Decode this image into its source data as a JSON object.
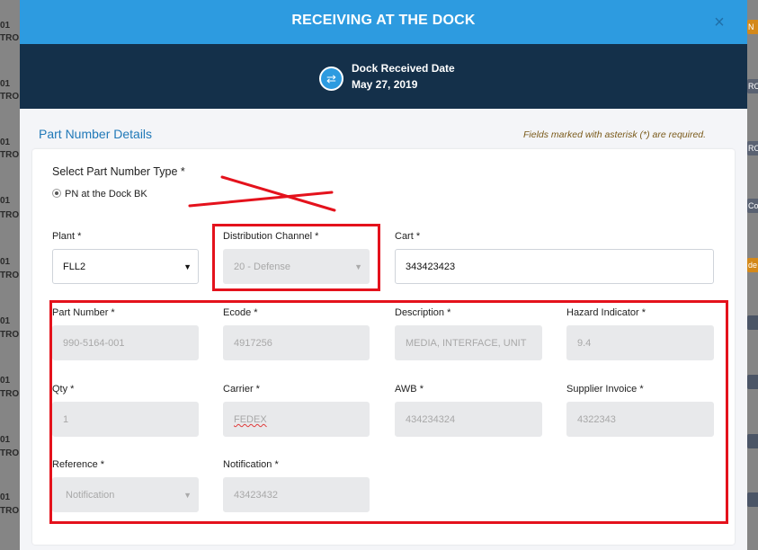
{
  "background": {
    "left_fragments": [
      "01",
      "TRO",
      "01",
      "TRO",
      "01",
      "TRO",
      "01",
      "TRO",
      "01",
      "TRO",
      "01",
      "TRO",
      "01",
      "TRO",
      "01",
      "TRO",
      "01",
      "TRO",
      "01",
      "TRO"
    ],
    "right_fragments": [
      "N",
      "RO",
      "RO",
      "Co",
      "de"
    ]
  },
  "modal": {
    "title": "RECEIVING AT THE DOCK",
    "close_label": "×",
    "dock": {
      "label": "Dock Received Date",
      "date": "May 27, 2019",
      "icon": "swap-arrows-icon"
    },
    "section_title": "Part Number Details",
    "required_note": "Fields marked with asterisk (*) are required.",
    "part_type": {
      "label": "Select Part Number Type *",
      "option_label": "PN at the Dock BK",
      "selected": true
    },
    "fields": {
      "plant": {
        "label": "Plant *",
        "value": "FLL2"
      },
      "distribution_channel": {
        "label": "Distribution Channel *",
        "value": "20 - Defense"
      },
      "cart": {
        "label": "Cart *",
        "value": "343423423"
      },
      "part_number": {
        "label": "Part Number *",
        "value": "990-5164-001"
      },
      "ecode": {
        "label": "Ecode *",
        "value": "4917256"
      },
      "description": {
        "label": "Description *",
        "value": "MEDIA, INTERFACE, UNIT"
      },
      "hazard_indicator": {
        "label": "Hazard Indicator *",
        "value": "9.4"
      },
      "qty": {
        "label": "Qty *",
        "value": "1"
      },
      "carrier": {
        "label": "Carrier *",
        "value": "FEDEX"
      },
      "awb": {
        "label": "AWB *",
        "value": "434234324"
      },
      "supplier_invoice": {
        "label": "Supplier Invoice *",
        "value": "4322343"
      },
      "reference": {
        "label": "Reference *",
        "value": "Notification"
      },
      "notification": {
        "label": "Notification *",
        "value": "43423432"
      }
    },
    "colors": {
      "header": "#2d9be0",
      "dock_band": "#14304a",
      "section_title": "#2179b8",
      "annotation_red": "#e4121c"
    }
  }
}
